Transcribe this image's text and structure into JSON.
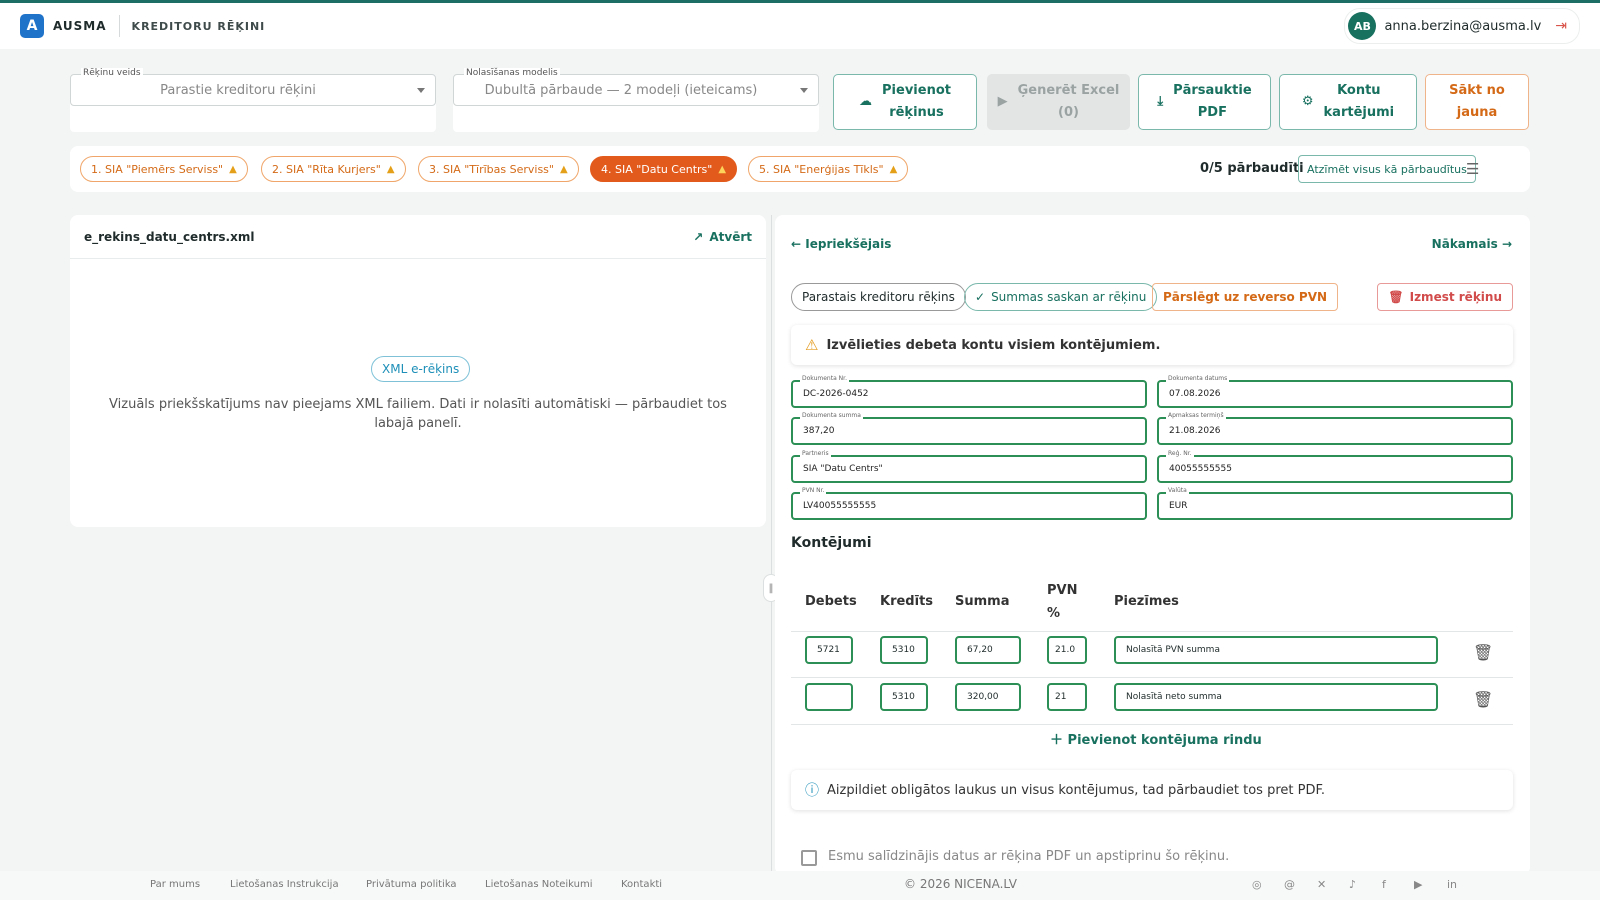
{
  "header": {
    "logo_letter": "A",
    "brand": "AUSMA",
    "app_title": "KREDITORU RĒĶINI",
    "avatar_initials": "AB",
    "email": "anna.berzina@ausma.lv"
  },
  "controls": {
    "invoice_type_label": "Rēķinu veids",
    "invoice_type_value": "Parastie kreditoru rēķini",
    "model_label": "Nolasīšanas modelis",
    "model_value": "Dubultā pārbaude — 2 modeļi (ieteicams)",
    "btn_add": [
      "Pievienot",
      "rēķinus"
    ],
    "btn_excel": [
      "Ģenerēt Excel",
      "(0)"
    ],
    "btn_reread": [
      "Pārsauktie",
      "PDF"
    ],
    "btn_accounts": [
      "Kontu",
      "kartējumi"
    ],
    "btn_restart": [
      "Sākt no",
      "jauna"
    ]
  },
  "invoice_chips": [
    {
      "label": "1. SIA \"Piemērs Serviss\"",
      "active": false
    },
    {
      "label": "2. SIA \"Rīta Kurjers\"",
      "active": false
    },
    {
      "label": "3. SIA \"Tīrības Serviss\"",
      "active": false
    },
    {
      "label": "4. SIA \"Datu Centrs\"",
      "active": true
    },
    {
      "label": "5. SIA \"Enerģijas Tīkls\"",
      "active": false
    }
  ],
  "checked_count": "0/5 pārbaudīti",
  "mark_all_label": "Atzīmēt visus kā pārbaudītus",
  "preview": {
    "filename": "e_rekins_datu_centrs.xml",
    "open_label": "Atvērt",
    "badge": "XML e-rēķins",
    "message": "Vizuāls priekšskatījums nav pieejams XML failiem. Dati ir nolasīti automātiski — pārbaudiet tos labajā panelī."
  },
  "detail": {
    "prev_label": "Iepriekšējais",
    "next_label": "Nākamais",
    "tag_type": "Parastais kreditoru rēķins",
    "tag_sums": "Summas saskan ar rēķinu",
    "tag_reverse": "Pārslēgt uz reverso PVN",
    "tag_discard": "Izmest rēķinu",
    "alert": "Izvēlieties debeta kontu visiem kontējumiem.",
    "fields": [
      {
        "label": "Dokumenta Nr.",
        "value": "DC-2026-0452"
      },
      {
        "label": "Dokumenta datums",
        "value": "07.08.2026"
      },
      {
        "label": "Dokumenta summa",
        "value": "387,20"
      },
      {
        "label": "Apmaksas termiņš",
        "value": "21.08.2026"
      },
      {
        "label": "Partneris",
        "value": "SIA \"Datu Centrs\""
      },
      {
        "label": "Reģ. Nr.",
        "value": "40055555555"
      },
      {
        "label": "PVN Nr.",
        "value": "LV40055555555"
      },
      {
        "label": "Valūta",
        "value": "EUR"
      }
    ],
    "section_title": "Kontējumi",
    "columns": [
      "Debets",
      "Kredīts",
      "Summa",
      "PVN",
      "%",
      "Piezīmes"
    ],
    "rows": [
      {
        "debit": "5721",
        "credit": "5310",
        "amount": "67,20",
        "vat": "21.0",
        "note": "Nolasītā PVN summa"
      },
      {
        "debit": "",
        "credit": "5310",
        "amount": "320,00",
        "vat": "21",
        "note": "Nolasītā neto summa"
      }
    ],
    "add_row": "Pievienot kontējuma rindu",
    "info": "Aizpildiet obligātos laukus un visus kontējumus, tad pārbaudiet tos pret PDF.",
    "confirm": "Esmu salīdzinājis datus ar rēķina PDF un apstiprinu šo rēķinu."
  },
  "footer": {
    "links": [
      "Par mums",
      "Lietošanas Instrukcija",
      "Privātuma politika",
      "Lietošanas Noteikumi",
      "Kontakti"
    ],
    "copyright": "© 2026 NICENA.LV"
  },
  "colors": {
    "accent": "#18705f",
    "active_chip": "#e35b1c",
    "warning": "#e39a1c",
    "field_border": "#2c8f55"
  }
}
